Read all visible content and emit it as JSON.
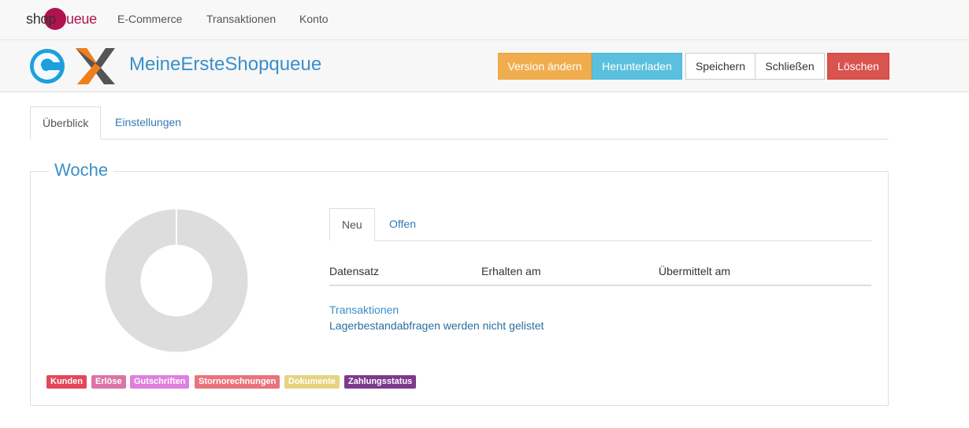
{
  "topnav": {
    "brand": {
      "part1": "shop",
      "part2": "Q",
      "part3": "ueue"
    },
    "links": [
      "E-Commerce",
      "Transaktionen",
      "Konto"
    ]
  },
  "header": {
    "title": "MeineErsteShopqueue",
    "buttons": {
      "version": "Version ändern",
      "download": "Herunterladen",
      "save": "Speichern",
      "close": "Schließen",
      "delete": "Löschen"
    }
  },
  "tabs": [
    "Überblick",
    "Einstellungen"
  ],
  "panel": {
    "legend": "Woche",
    "badges": [
      {
        "label": "Kunden",
        "color": "#e2485a"
      },
      {
        "label": "Erlöse",
        "color": "#d974a6"
      },
      {
        "label": "Gutschriften",
        "color": "#e07fe0"
      },
      {
        "label": "Stornorechnungen",
        "color": "#e8737b"
      },
      {
        "label": "Dokumente",
        "color": "#e6d37f"
      },
      {
        "label": "Zahlungsstatus",
        "color": "#7d3a8c"
      }
    ],
    "inner_tabs": [
      "Neu",
      "Offen"
    ],
    "columns": [
      "Datensatz",
      "Erhalten am",
      "Übermittelt am"
    ],
    "links": {
      "transactions": "Transaktionen",
      "stock_note": "Lagerbestandabfragen werden nicht gelistet"
    }
  },
  "colors": {
    "accent": "#3a8fc9",
    "brand": "#b0134f",
    "donut": "#dddddd"
  }
}
